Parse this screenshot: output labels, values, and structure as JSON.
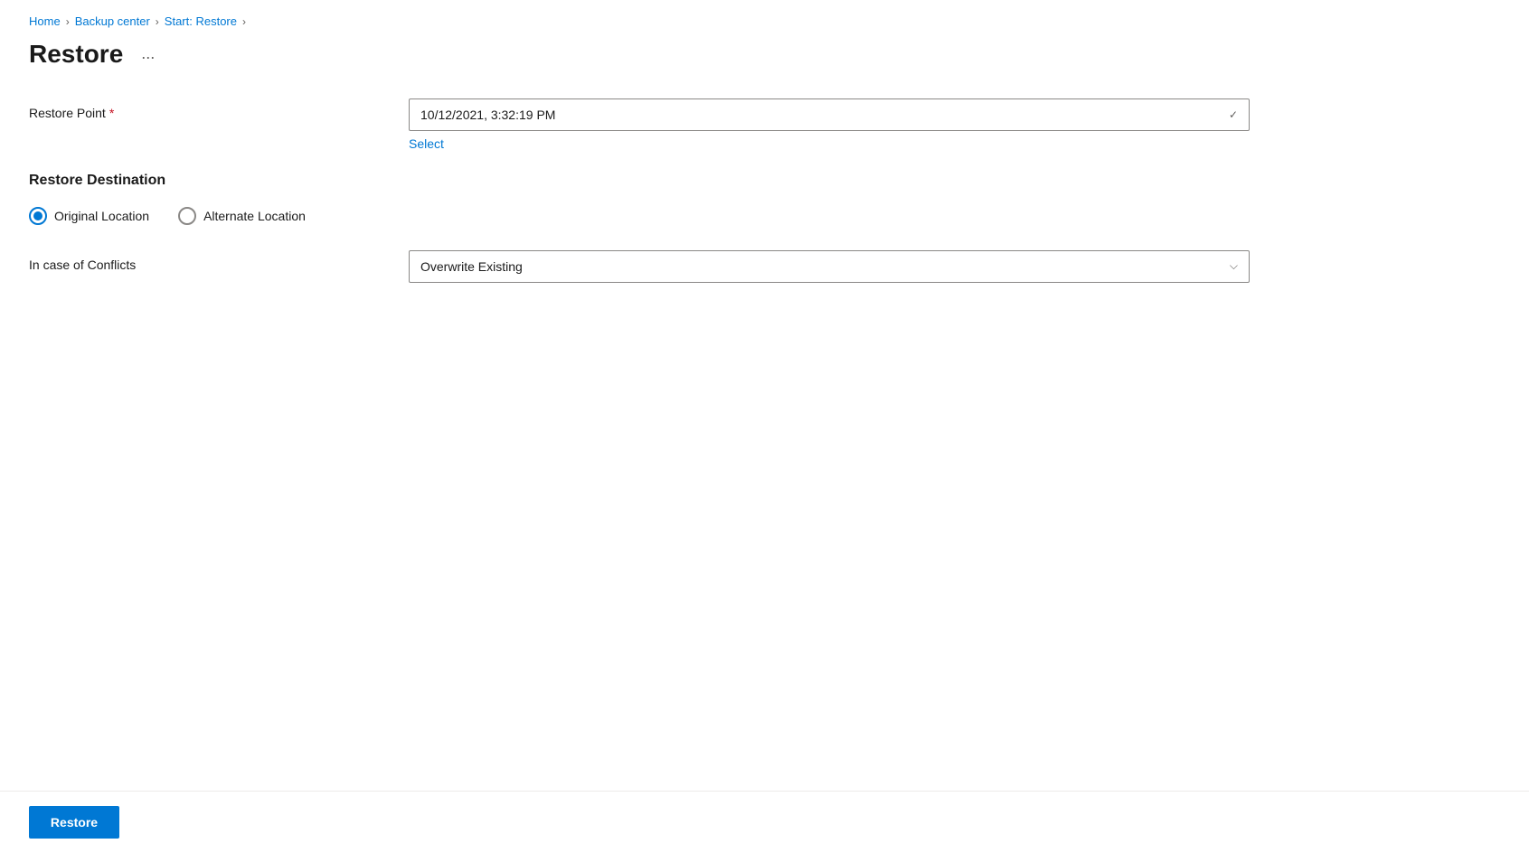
{
  "breadcrumb": {
    "home": "Home",
    "backup_center": "Backup center",
    "current": "Start: Restore"
  },
  "page": {
    "title": "Restore",
    "more_options_label": "..."
  },
  "form": {
    "restore_point": {
      "label": "Restore Point",
      "required": true,
      "value": "10/12/2021, 3:32:19 PM",
      "select_link": "Select"
    },
    "restore_destination": {
      "section_label": "Restore Destination",
      "options": [
        {
          "id": "original",
          "label": "Original Location",
          "selected": true
        },
        {
          "id": "alternate",
          "label": "Alternate Location",
          "selected": false
        }
      ]
    },
    "conflicts": {
      "label": "In case of Conflicts",
      "value": "Overwrite Existing"
    }
  },
  "footer": {
    "restore_button": "Restore"
  },
  "icons": {
    "chevron_down": "⌄",
    "check": "✓"
  }
}
